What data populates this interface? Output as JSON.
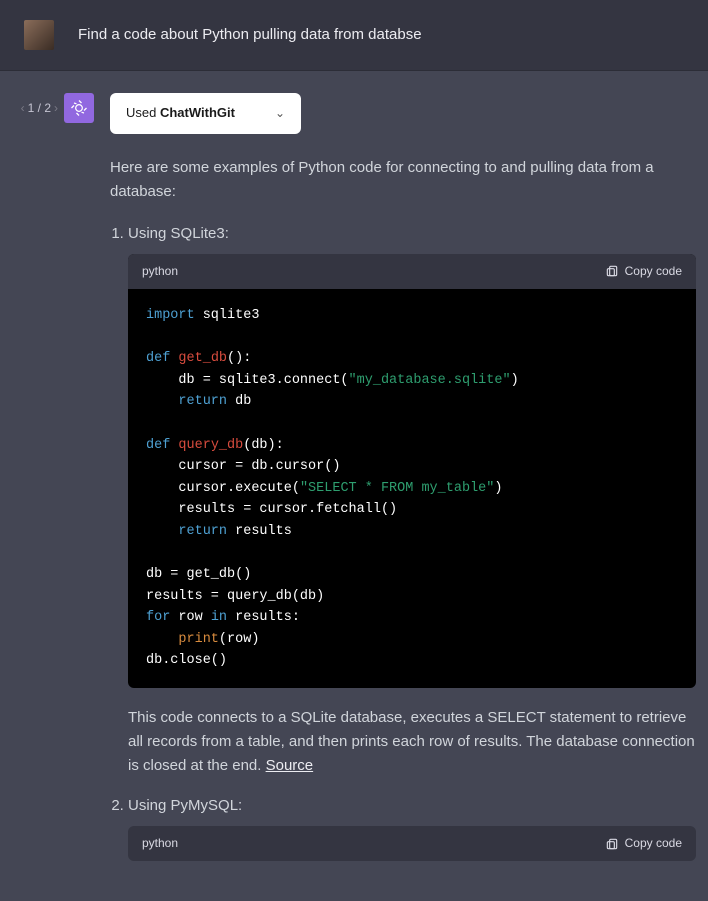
{
  "user": {
    "prompt": "Find a code about Python pulling data from databse"
  },
  "pager": {
    "prev": "‹",
    "label": "1 / 2",
    "next": "›"
  },
  "assistant": {
    "dropdown_prefix": "Used ",
    "dropdown_tool": "ChatWithGit",
    "intro": "Here are some examples of Python code for connecting to and pulling data from a database:",
    "item1_title": "Using SQLite3:",
    "item1_explain": "This code connects to a SQLite database, executes a SELECT statement to retrieve all records from a table, and then prints each row of results. The database connection is closed at the end. ",
    "source_label": "Source",
    "item2_title": "Using PyMySQL:"
  },
  "code": {
    "lang": "python",
    "copy_label": "Copy code"
  }
}
